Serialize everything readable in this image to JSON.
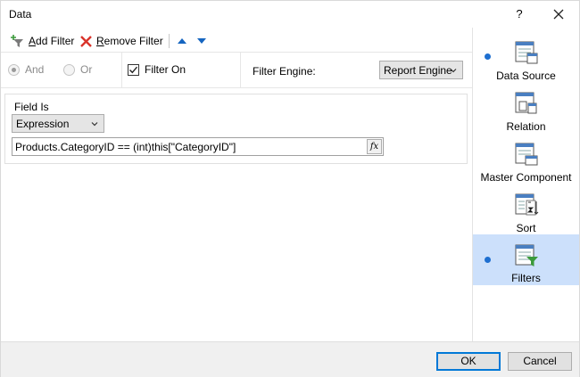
{
  "window": {
    "title": "Data",
    "help_label": "?"
  },
  "toolbar": {
    "add_filter": {
      "underlined": "A",
      "rest": "dd Filter"
    },
    "remove_filter": {
      "underlined": "R",
      "rest": "emove Filter"
    }
  },
  "options": {
    "and_label": "And",
    "or_label": "Or",
    "filter_on_label": "Filter On",
    "filter_on_checked": true,
    "engine_label": "Filter Engine:",
    "engine_value": "Report Engine"
  },
  "filter_item": {
    "field_is_label": "Field Is",
    "field_type_value": "Expression",
    "expression_value": "Products.CategoryID == (int)this[\"CategoryID\"]",
    "fx_label": "fx"
  },
  "nav": [
    {
      "label": "Data Source",
      "has_bullet": true,
      "selected": false
    },
    {
      "label": "Relation",
      "has_bullet": false,
      "selected": false
    },
    {
      "label": "Master Component",
      "has_bullet": false,
      "selected": false
    },
    {
      "label": "Sort",
      "has_bullet": false,
      "selected": false
    },
    {
      "label": "Filters",
      "has_bullet": true,
      "selected": true
    }
  ],
  "footer": {
    "ok_label": "OK",
    "cancel_label": "Cancel"
  },
  "colors": {
    "accent": "#1e6fd0",
    "selection": "#cce0fb",
    "remove_red": "#d9342b",
    "arrow_blue": "#1565c0"
  }
}
